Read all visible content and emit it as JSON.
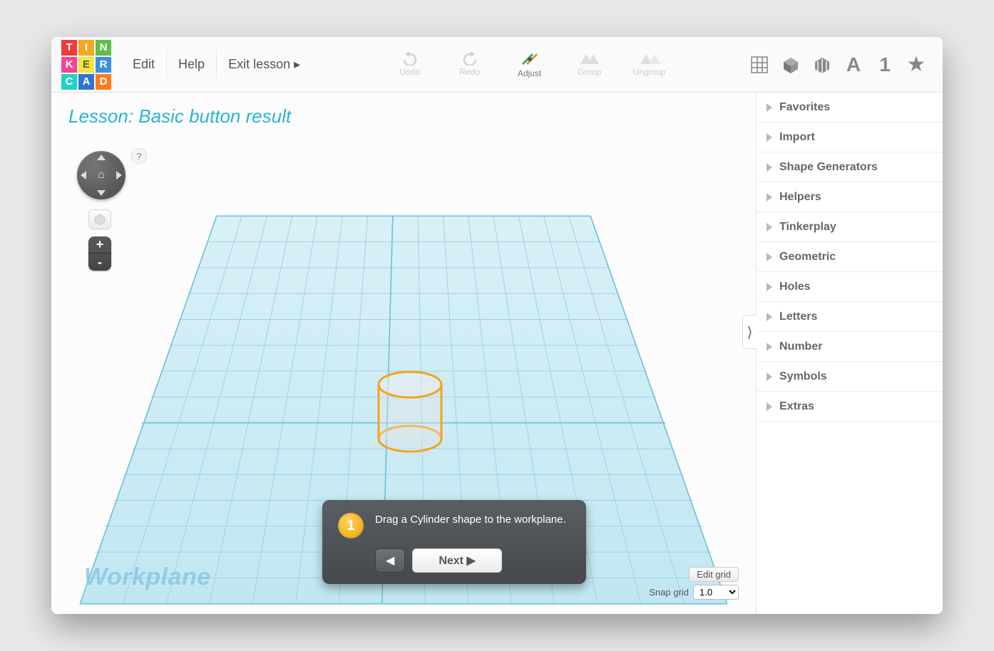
{
  "logo": {
    "cells": [
      {
        "c": "#ef3b3b",
        "t": "T"
      },
      {
        "c": "#f5a623",
        "t": "I"
      },
      {
        "c": "#5fbf4b",
        "t": "N"
      },
      {
        "c": "#f54394",
        "t": "K"
      },
      {
        "c": "#f5e538",
        "t": "E"
      },
      {
        "c": "#3b8fe2",
        "t": "R"
      },
      {
        "c": "#23d0c9",
        "t": "C"
      },
      {
        "c": "#2f74d0",
        "t": "A"
      },
      {
        "c": "#ff7a1f",
        "t": "D"
      }
    ]
  },
  "menu": {
    "edit": "Edit",
    "help": "Help",
    "exit": "Exit lesson ▸"
  },
  "tools": {
    "undo": "Undo",
    "redo": "Redo",
    "adjust": "Adjust",
    "group": "Group",
    "ungroup": "Ungroup"
  },
  "lesson": {
    "prefix": "Lesson: ",
    "title": "Basic button result"
  },
  "orb_help": "?",
  "zoom": {
    "plus": "+",
    "minus": "-"
  },
  "workplane_label": "Workplane",
  "popover": {
    "step": "1",
    "text": "Drag a Cylinder shape to the workplane.",
    "prev": "◀",
    "next": "Next ▶"
  },
  "grid_controls": {
    "edit": "Edit grid",
    "snap_label": "Snap grid",
    "snap_value": "1.0"
  },
  "categories": [
    "Favorites",
    "Import",
    "Shape Generators",
    "Helpers",
    "Tinkerplay",
    "Geometric",
    "Holes",
    "Letters",
    "Number",
    "Symbols",
    "Extras"
  ],
  "right_tabs": [
    "grid",
    "box",
    "stripes",
    "A",
    "1",
    "star"
  ]
}
